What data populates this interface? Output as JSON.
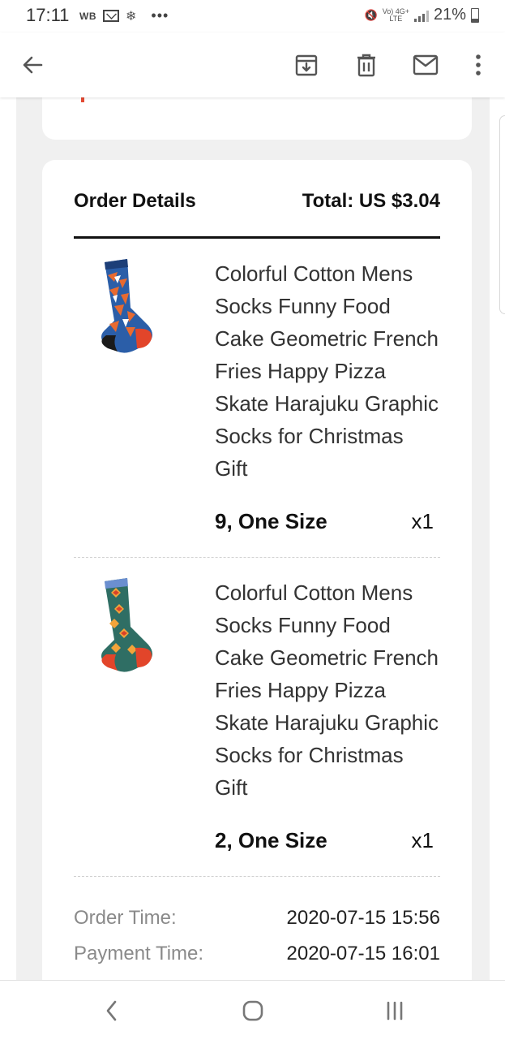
{
  "status_bar": {
    "time": "17:11",
    "carrier_label": "WB",
    "network_top": "Vo) 4G+",
    "network_bottom": "LTE",
    "battery_percent": "21%",
    "battery_level": 0.21
  },
  "action_bar": {
    "icons": [
      "back-arrow-icon",
      "archive-icon",
      "trash-icon",
      "mail-icon",
      "more-vert-icon"
    ]
  },
  "order": {
    "heading": "Order Details",
    "total": "Total: US $3.04",
    "items": [
      {
        "title": "Colorful Cotton Mens Socks Funny Food Cake Geometric French Fries Happy Pizza Skate Harajuku Graphic Socks for Christmas Gift",
        "variant": "9, One Size",
        "quantity": "x1"
      },
      {
        "title": "Colorful Cotton Mens Socks Funny Food Cake Geometric French Fries Happy Pizza Skate Harajuku Graphic Socks for Christmas Gift",
        "variant": "2, One Size",
        "quantity": "x1"
      }
    ],
    "order_time_label": "Order Time:",
    "order_time": "2020-07-15 15:56",
    "payment_time_label": "Payment Time:",
    "payment_time": "2020-07-15 16:01"
  },
  "colors": {
    "accent_red": "#e34a33",
    "text_dark": "#111111",
    "label_gray": "#8a8a8a",
    "background_gray": "#f0f0f0"
  }
}
